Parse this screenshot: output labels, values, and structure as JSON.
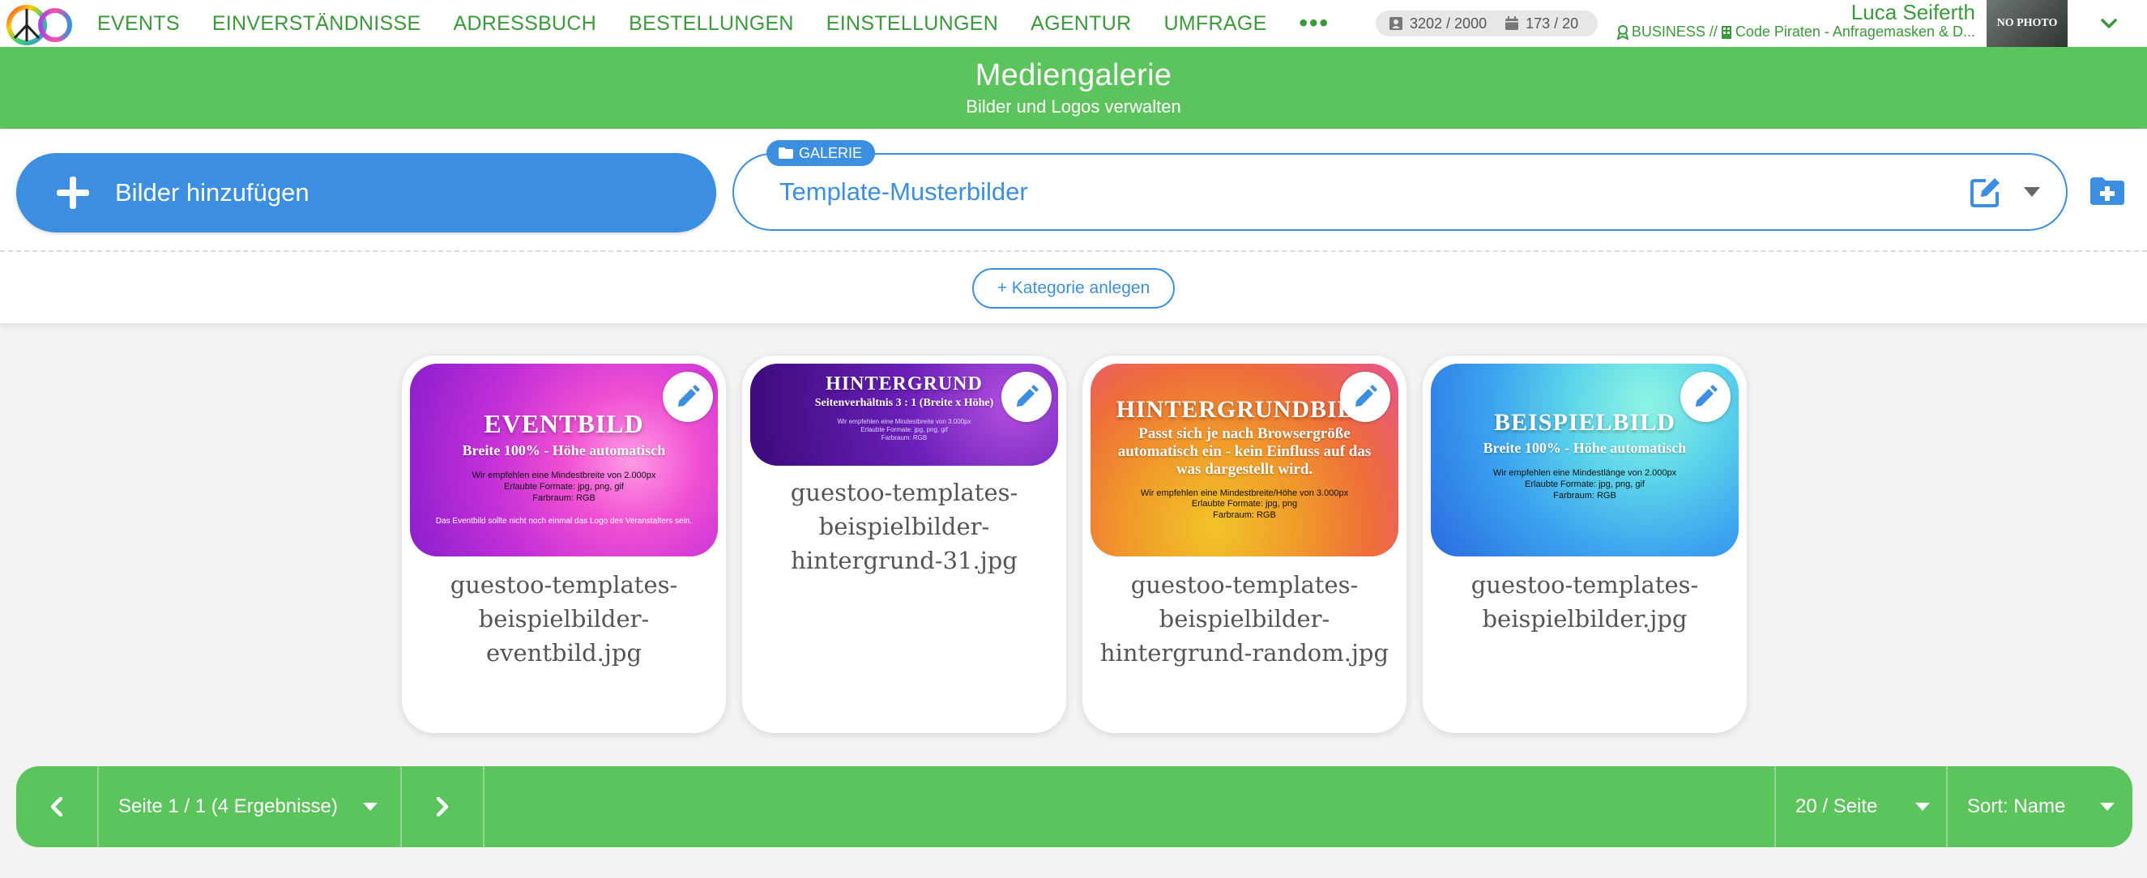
{
  "nav": {
    "items": [
      "EVENTS",
      "EINVERSTÄNDNISSE",
      "ADRESSBUCH",
      "BESTELLUNGEN",
      "EINSTELLUNGEN",
      "AGENTUR",
      "UMFRAGE"
    ],
    "more": "•••"
  },
  "counters": {
    "contacts": "3202 / 2000",
    "events": "173 / 20"
  },
  "user": {
    "name": "Luca Seiferth",
    "plan": "BUSINESS //",
    "company": "Code Piraten - Anfragemasken & D...",
    "avatar_text": "NO PHOTO"
  },
  "header": {
    "title": "Mediengalerie",
    "subtitle": "Bilder und Logos verwalten"
  },
  "toolbar": {
    "add_images": "Bilder hinzufügen",
    "gallery_badge": "GALERIE",
    "gallery_value": "Template-Musterbilder",
    "add_category": "+ Kategorie anlegen"
  },
  "cards": [
    {
      "thumb_title": "EVENTBILD",
      "thumb_sub": "Breite 100% - Höhe automatisch",
      "thumb_lines": [
        "Wir empfehlen eine Mindestbreite von 2.000px",
        "Erlaubte Formate: jpg, png, gif",
        "Farbraum: RGB"
      ],
      "thumb_foot": "Das Eventbild sollte nicht noch einmal das Logo des Veranstalters sein.",
      "name": "guestoo-templates-beispielbilder-eventbild.jpg"
    },
    {
      "thumb_title": "HINTERGRUND",
      "thumb_sub": "Seitenverhältnis 3 : 1 (Breite x Höhe)",
      "thumb_lines": [
        "Wir empfehlen eine Mindestbreite von 3.000px",
        "Erlaubte Formate: jpg, png, gif",
        "Farbraum: RGB"
      ],
      "name": "guestoo-templates-beispielbilder-hintergrund-31.jpg"
    },
    {
      "thumb_title": "HINTERGRUNDBILD",
      "thumb_sub": "Passt sich je nach Browsergröße automatisch ein - kein Einfluss auf das was dargestellt wird.",
      "thumb_lines": [
        "Wir empfehlen eine Mindestbreite/Höhe von 3.000px",
        "Erlaubte Formate: jpg, png",
        "Farbraum: RGB"
      ],
      "name": "guestoo-templates-beispielbilder-hintergrund-random.jpg"
    },
    {
      "thumb_title": "BEISPIELBILD",
      "thumb_sub": "Breite 100% - Höhe automatisch",
      "thumb_lines": [
        "Wir empfehlen eine Mindestlänge von 2.000px",
        "Erlaubte Formate: jpg, png, gif",
        "Farbraum: RGB"
      ],
      "name": "guestoo-templates-beispielbilder.jpg"
    }
  ],
  "pager": {
    "page_info": "Seite 1 / 1 (4 Ergebnisse)",
    "per_page": "20 / Seite",
    "sort": "Sort: Name"
  },
  "colors": {
    "green": "#5cc45c",
    "nav_green": "#3a9a3a",
    "blue": "#3b8ee0"
  }
}
